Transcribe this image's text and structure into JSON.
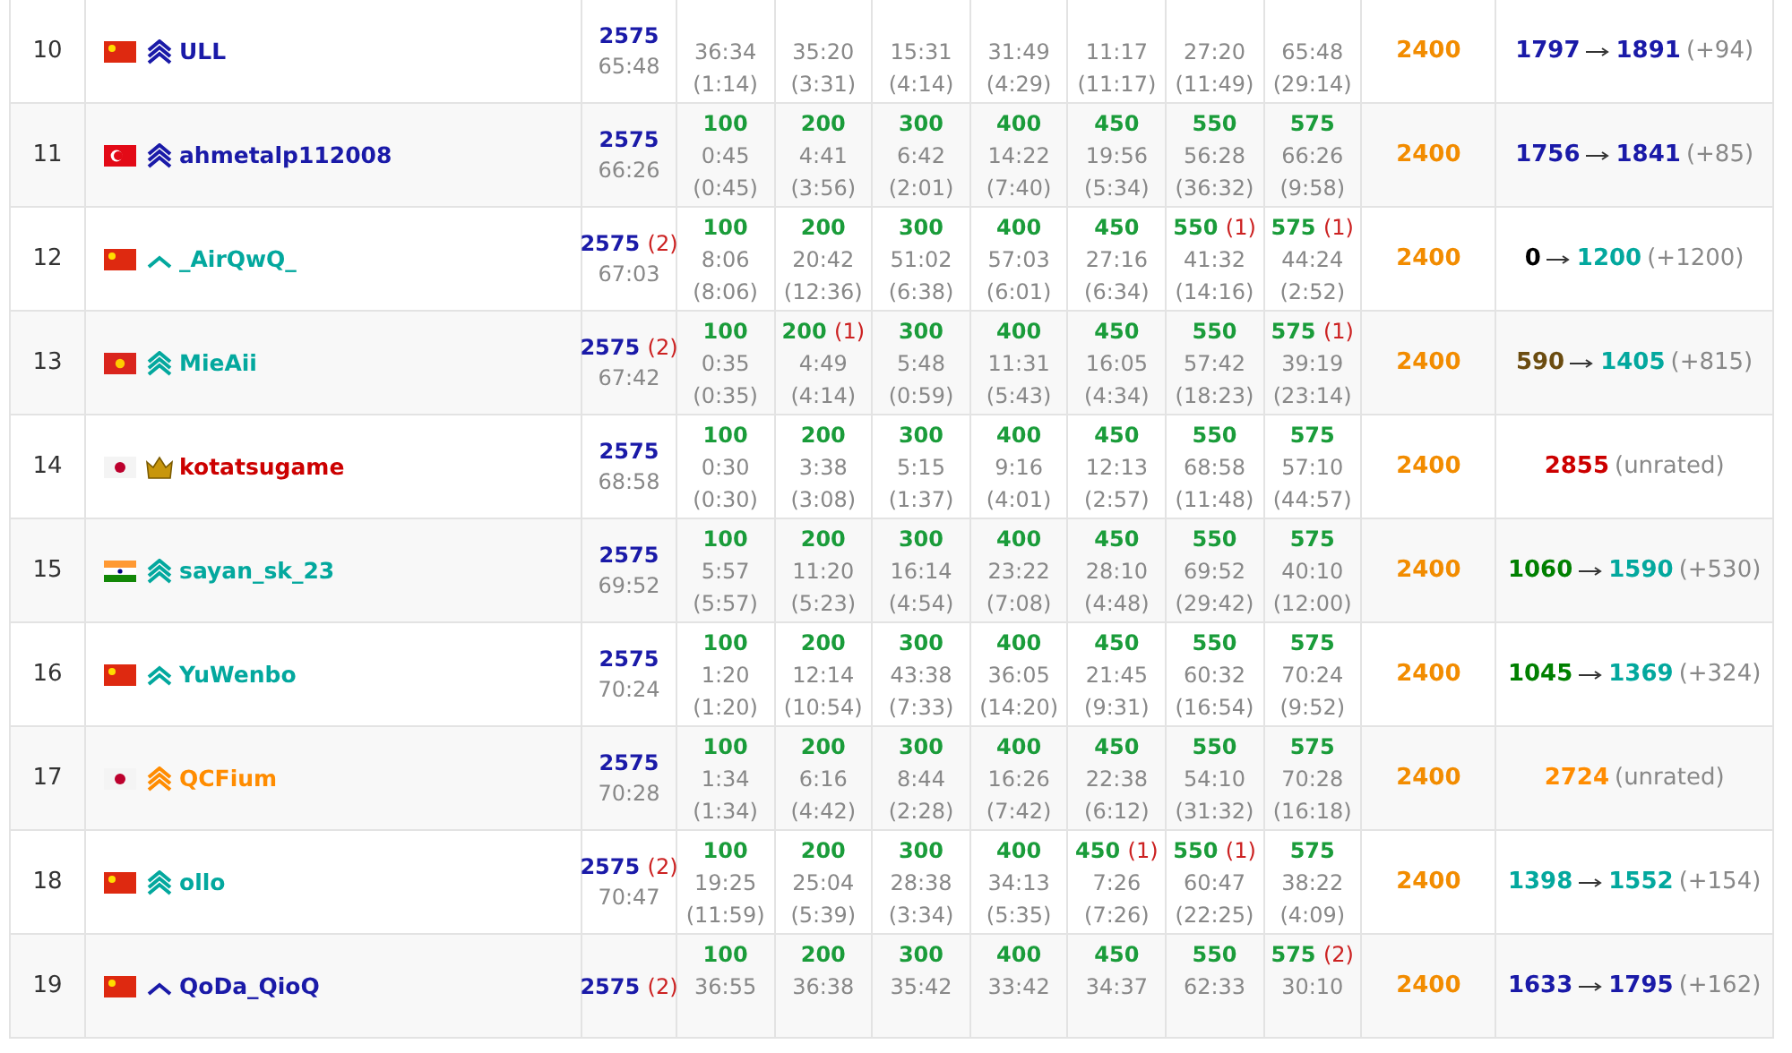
{
  "rows": [
    {
      "rank": "10",
      "flag": {
        "kind": "cn"
      },
      "rank_icon": {
        "kind": "triple"
      },
      "name": "ULL",
      "color": "#1a1aa8",
      "score": "2575",
      "penalty": "65:48",
      "problems": [
        {
          "time": "36:34",
          "since": "(1:14)"
        },
        {
          "time": "35:20",
          "since": "(3:31)"
        },
        {
          "time": "15:31",
          "since": "(4:14)"
        },
        {
          "time": "31:49",
          "since": "(4:29)"
        },
        {
          "time": "11:17",
          "since": "(11:17)"
        },
        {
          "time": "27:20",
          "since": "(11:49)"
        },
        {
          "time": "65:48",
          "since": "(29:14)"
        }
      ],
      "cap": "2400",
      "rating": {
        "kind": "change",
        "old": {
          "text": "1797",
          "color": "#1a1aa8"
        },
        "new": {
          "text": "1891",
          "color": "#1a1aa8"
        },
        "delta": "(+94)"
      }
    },
    {
      "rank": "11",
      "flag": {
        "kind": "tr"
      },
      "rank_icon": {
        "kind": "triple"
      },
      "name": "ahmetalp112008",
      "color": "#1a1aa8",
      "score": "2575",
      "penalty": "66:26",
      "problems": [
        {
          "points": "100",
          "time": "0:45",
          "since": "(0:45)"
        },
        {
          "points": "200",
          "time": "4:41",
          "since": "(3:56)"
        },
        {
          "points": "300",
          "time": "6:42",
          "since": "(2:01)"
        },
        {
          "points": "400",
          "time": "14:22",
          "since": "(7:40)"
        },
        {
          "points": "450",
          "time": "19:56",
          "since": "(5:34)"
        },
        {
          "points": "550",
          "time": "56:28",
          "since": "(36:32)"
        },
        {
          "points": "575",
          "time": "66:26",
          "since": "(9:58)"
        }
      ],
      "cap": "2400",
      "rating": {
        "kind": "change",
        "old": {
          "text": "1756",
          "color": "#1a1aa8"
        },
        "new": {
          "text": "1841",
          "color": "#1a1aa8"
        },
        "delta": "(+85)"
      }
    },
    {
      "rank": "12",
      "flag": {
        "kind": "cn"
      },
      "rank_icon": {
        "kind": "single"
      },
      "name": "_AirQwQ_",
      "color": "#03a89e",
      "score": "2575",
      "wrong": "(2)",
      "penalty": "67:03",
      "problems": [
        {
          "points": "100",
          "time": "8:06",
          "since": "(8:06)"
        },
        {
          "points": "200",
          "time": "20:42",
          "since": "(12:36)"
        },
        {
          "points": "300",
          "time": "51:02",
          "since": "(6:38)"
        },
        {
          "points": "400",
          "time": "57:03",
          "since": "(6:01)"
        },
        {
          "points": "450",
          "time": "27:16",
          "since": "(6:34)"
        },
        {
          "points": "550",
          "wrong": "(1)",
          "time": "41:32",
          "since": "(14:16)"
        },
        {
          "points": "575",
          "wrong": "(1)",
          "time": "44:24",
          "since": "(2:52)"
        }
      ],
      "cap": "2400",
      "rating": {
        "kind": "change",
        "old": {
          "text": "0",
          "color": "#000000"
        },
        "new": {
          "text": "1200",
          "color": "#03a89e"
        },
        "delta": "(+1200)"
      }
    },
    {
      "rank": "13",
      "flag": {
        "kind": "vn"
      },
      "rank_icon": {
        "kind": "triple"
      },
      "name": "MieAii",
      "color": "#03a89e",
      "score": "2575",
      "wrong": "(2)",
      "penalty": "67:42",
      "problems": [
        {
          "points": "100",
          "time": "0:35",
          "since": "(0:35)"
        },
        {
          "points": "200",
          "wrong": "(1)",
          "time": "4:49",
          "since": "(4:14)"
        },
        {
          "points": "300",
          "time": "5:48",
          "since": "(0:59)"
        },
        {
          "points": "400",
          "time": "11:31",
          "since": "(5:43)"
        },
        {
          "points": "450",
          "time": "16:05",
          "since": "(4:34)"
        },
        {
          "points": "550",
          "time": "57:42",
          "since": "(18:23)"
        },
        {
          "points": "575",
          "wrong": "(1)",
          "time": "39:19",
          "since": "(23:14)"
        }
      ],
      "cap": "2400",
      "rating": {
        "kind": "change",
        "old": {
          "text": "590",
          "color": "#6b4c10"
        },
        "new": {
          "text": "1405",
          "color": "#03a89e"
        },
        "delta": "(+815)"
      }
    },
    {
      "rank": "14",
      "flag": {
        "kind": "jp"
      },
      "rank_icon": {
        "kind": "crown"
      },
      "name": "kotatsugame",
      "color": "#cc0000",
      "score": "2575",
      "penalty": "68:58",
      "problems": [
        {
          "points": "100",
          "time": "0:30",
          "since": "(0:30)"
        },
        {
          "points": "200",
          "time": "3:38",
          "since": "(3:08)"
        },
        {
          "points": "300",
          "time": "5:15",
          "since": "(1:37)"
        },
        {
          "points": "400",
          "time": "9:16",
          "since": "(4:01)"
        },
        {
          "points": "450",
          "time": "12:13",
          "since": "(2:57)"
        },
        {
          "points": "550",
          "time": "68:58",
          "since": "(11:48)"
        },
        {
          "points": "575",
          "time": "57:10",
          "since": "(44:57)"
        }
      ],
      "cap": "2400",
      "rating": {
        "kind": "unrated",
        "old": {
          "text": "2855",
          "color": "#cc0000"
        },
        "delta": "(unrated)"
      }
    },
    {
      "rank": "15",
      "flag": {
        "kind": "in"
      },
      "rank_icon": {
        "kind": "triple"
      },
      "name": "sayan_sk_23",
      "color": "#03a89e",
      "score": "2575",
      "penalty": "69:52",
      "problems": [
        {
          "points": "100",
          "time": "5:57",
          "since": "(5:57)"
        },
        {
          "points": "200",
          "time": "11:20",
          "since": "(5:23)"
        },
        {
          "points": "300",
          "time": "16:14",
          "since": "(4:54)"
        },
        {
          "points": "400",
          "time": "23:22",
          "since": "(7:08)"
        },
        {
          "points": "450",
          "time": "28:10",
          "since": "(4:48)"
        },
        {
          "points": "550",
          "time": "69:52",
          "since": "(29:42)"
        },
        {
          "points": "575",
          "time": "40:10",
          "since": "(12:00)"
        }
      ],
      "cap": "2400",
      "rating": {
        "kind": "change",
        "old": {
          "text": "1060",
          "color": "#008000"
        },
        "new": {
          "text": "1590",
          "color": "#03a89e"
        },
        "delta": "(+530)"
      }
    },
    {
      "rank": "16",
      "flag": {
        "kind": "cn"
      },
      "rank_icon": {
        "kind": "double"
      },
      "name": "YuWenbo",
      "color": "#03a89e",
      "score": "2575",
      "penalty": "70:24",
      "problems": [
        {
          "points": "100",
          "time": "1:20",
          "since": "(1:20)"
        },
        {
          "points": "200",
          "time": "12:14",
          "since": "(10:54)"
        },
        {
          "points": "300",
          "time": "43:38",
          "since": "(7:33)"
        },
        {
          "points": "400",
          "time": "36:05",
          "since": "(14:20)"
        },
        {
          "points": "450",
          "time": "21:45",
          "since": "(9:31)"
        },
        {
          "points": "550",
          "time": "60:32",
          "since": "(16:54)"
        },
        {
          "points": "575",
          "time": "70:24",
          "since": "(9:52)"
        }
      ],
      "cap": "2400",
      "rating": {
        "kind": "change",
        "old": {
          "text": "1045",
          "color": "#008000"
        },
        "new": {
          "text": "1369",
          "color": "#03a89e"
        },
        "delta": "(+324)"
      }
    },
    {
      "rank": "17",
      "flag": {
        "kind": "jp"
      },
      "rank_icon": {
        "kind": "triple"
      },
      "name": "QCFium",
      "color": "#ff8c00",
      "score": "2575",
      "penalty": "70:28",
      "problems": [
        {
          "points": "100",
          "time": "1:34",
          "since": "(1:34)"
        },
        {
          "points": "200",
          "time": "6:16",
          "since": "(4:42)"
        },
        {
          "points": "300",
          "time": "8:44",
          "since": "(2:28)"
        },
        {
          "points": "400",
          "time": "16:26",
          "since": "(7:42)"
        },
        {
          "points": "450",
          "time": "22:38",
          "since": "(6:12)"
        },
        {
          "points": "550",
          "time": "54:10",
          "since": "(31:32)"
        },
        {
          "points": "575",
          "time": "70:28",
          "since": "(16:18)"
        }
      ],
      "cap": "2400",
      "rating": {
        "kind": "unrated",
        "old": {
          "text": "2724",
          "color": "#ff8c00"
        },
        "delta": "(unrated)"
      }
    },
    {
      "rank": "18",
      "flag": {
        "kind": "cn"
      },
      "rank_icon": {
        "kind": "triple"
      },
      "name": "ollo",
      "color": "#03a89e",
      "score": "2575",
      "wrong": "(2)",
      "penalty": "70:47",
      "problems": [
        {
          "points": "100",
          "time": "19:25",
          "since": "(11:59)"
        },
        {
          "points": "200",
          "time": "25:04",
          "since": "(5:39)"
        },
        {
          "points": "300",
          "time": "28:38",
          "since": "(3:34)"
        },
        {
          "points": "400",
          "time": "34:13",
          "since": "(5:35)"
        },
        {
          "points": "450",
          "wrong": "(1)",
          "time": "7:26",
          "since": "(7:26)"
        },
        {
          "points": "550",
          "wrong": "(1)",
          "time": "60:47",
          "since": "(22:25)"
        },
        {
          "points": "575",
          "time": "38:22",
          "since": "(4:09)"
        }
      ],
      "cap": "2400",
      "rating": {
        "kind": "change",
        "old": {
          "text": "1398",
          "color": "#03a89e"
        },
        "new": {
          "text": "1552",
          "color": "#03a89e"
        },
        "delta": "(+154)"
      }
    },
    {
      "rank": "19",
      "flag": {
        "kind": "cn"
      },
      "rank_icon": {
        "kind": "single"
      },
      "name": "QoDa_QioQ",
      "color": "#1a1aa8",
      "score": "2575",
      "wrong": "(2)",
      "problems": [
        {
          "points": "100",
          "time": "36:55"
        },
        {
          "points": "200",
          "time": "36:38"
        },
        {
          "points": "300",
          "time": "35:42"
        },
        {
          "points": "400",
          "time": "33:42"
        },
        {
          "points": "450",
          "time": "34:37"
        },
        {
          "points": "550",
          "time": "62:33"
        },
        {
          "points": "575",
          "wrong": "(2)",
          "time": "30:10"
        }
      ],
      "cap": "2400",
      "rating": {
        "kind": "change",
        "old": {
          "text": "1633",
          "color": "#1a1aa8"
        },
        "new": {
          "text": "1795",
          "color": "#1a1aa8"
        },
        "delta": "(+162)"
      }
    }
  ]
}
